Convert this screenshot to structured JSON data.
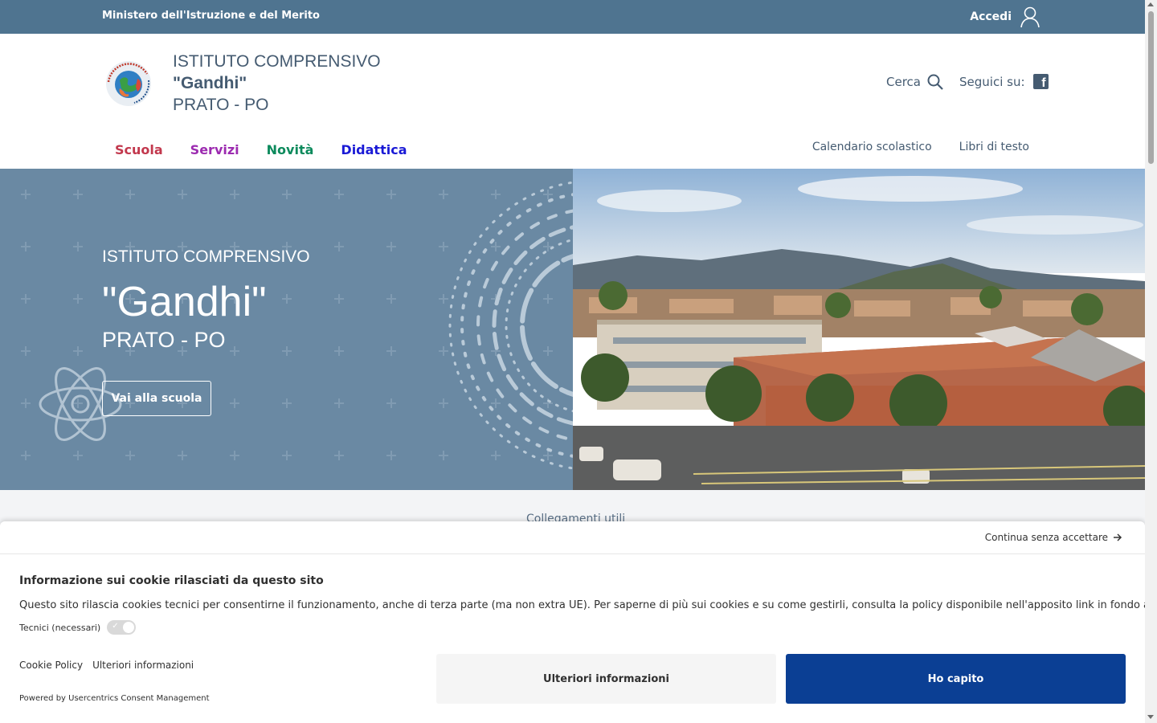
{
  "topbar": {
    "ministry": "Ministero dell'Istruzione e del Merito",
    "login_label": "Accedi"
  },
  "header": {
    "school_type": "ISTITUTO COMPRENSIVO",
    "school_name": "\"Gandhi\"",
    "school_place": "PRATO - PO",
    "search_label": "Cerca",
    "social_label": "Seguici su:",
    "logo_icon": "school-logo"
  },
  "nav": {
    "main": [
      {
        "label": "Scuola",
        "color": "#c2384d"
      },
      {
        "label": "Servizi",
        "color": "#9c2bb0"
      },
      {
        "label": "Novità",
        "color": "#0c8a5c"
      },
      {
        "label": "Didattica",
        "color": "#1a1ad6"
      }
    ],
    "secondary": [
      {
        "label": "Calendario scolastico"
      },
      {
        "label": "Libri di testo"
      }
    ]
  },
  "hero": {
    "kicker": "ISTITUTO COMPRENSIVO",
    "title": "\"Gandhi\"",
    "place": "PRATO - PO",
    "cta": "Vai alla scuola",
    "bg_color": "#6a89a3"
  },
  "below": {
    "links_title": "Collegamenti utili"
  },
  "cookie": {
    "continue_label": "Continua senza accettare",
    "title": "Informazione sui cookie rilasciati da questo sito",
    "description": "Questo sito rilascia cookies tecnici per consentirne il funzionamento, anche di terza parte (ma non extra UE). Per saperne di più sui cookies e su come gestirli, consulta la policy disponibile nell'apposito link in fondo alla pagina.",
    "technical_label": "Tecnici (necessari)",
    "policy_link": "Cookie Policy",
    "more_link": "Ulteriori informazioni",
    "powered_by": "Powered by Usercentrics Consent Management",
    "more_button": "Ulteriori informazioni",
    "accept_button": "Ho capito",
    "accept_color": "#0b3f94"
  }
}
